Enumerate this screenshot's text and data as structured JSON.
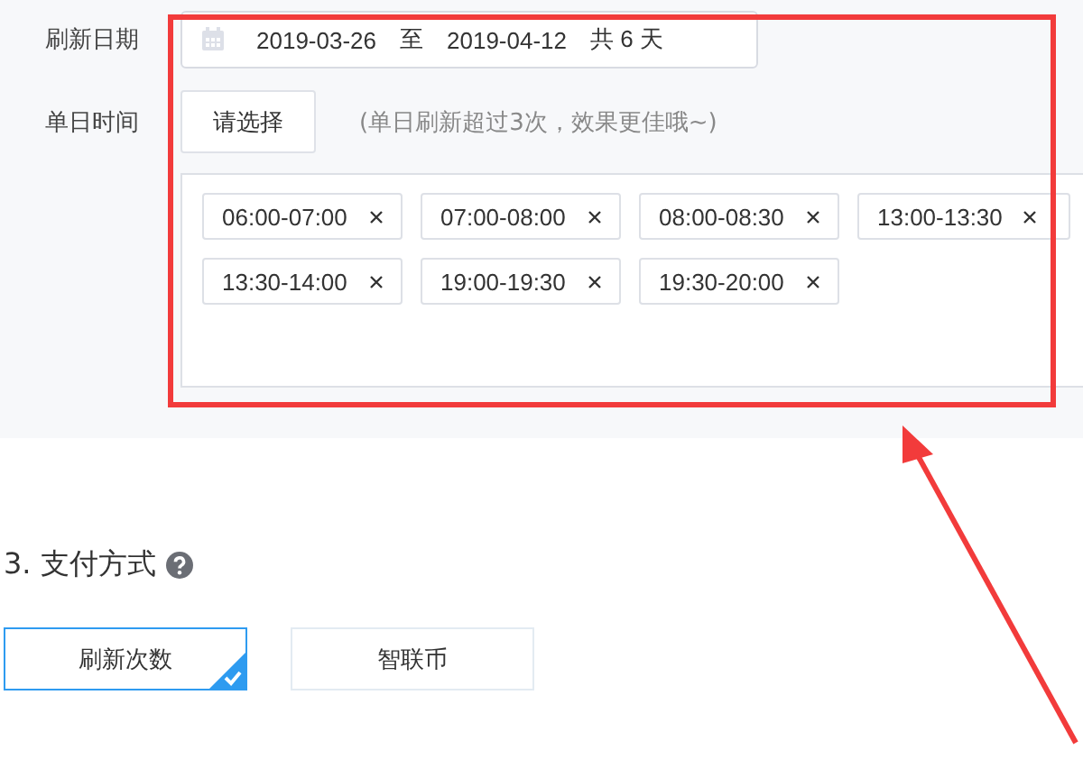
{
  "refresh_date": {
    "label": "刷新日期",
    "start": "2019-03-26",
    "separator": "至",
    "end": "2019-04-12",
    "total": "共 6 天"
  },
  "daily_time": {
    "label": "单日时间",
    "button": "请选择",
    "hint": "(单日刷新超过3次，效果更佳哦~)",
    "tags": [
      "06:00-07:00",
      "07:00-08:00",
      "08:00-08:30",
      "13:00-13:30",
      "13:30-14:00",
      "19:00-19:30",
      "19:30-20:00"
    ]
  },
  "payment": {
    "title": "3. 支付方式",
    "options": [
      {
        "label": "刷新次数",
        "selected": true
      },
      {
        "label": "智联币",
        "selected": false
      }
    ]
  }
}
